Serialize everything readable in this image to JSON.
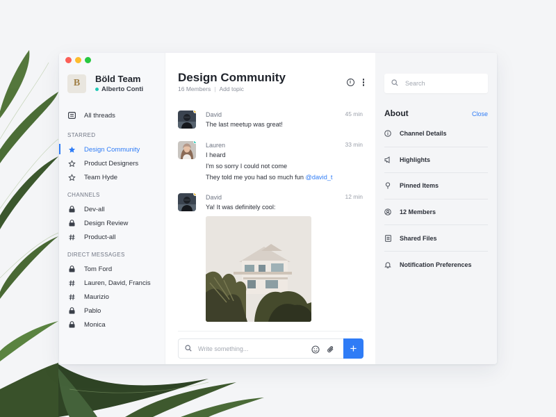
{
  "sidebar": {
    "team_logo": "B",
    "team_name": "Böld Team",
    "user_name": "Alberto Conti",
    "all_threads": "All threads",
    "starred_heading": "STARRED",
    "starred": [
      "Design Community",
      "Product Designers",
      "Team Hyde"
    ],
    "channels_heading": "CHANNELS",
    "channels": [
      "Dev-all",
      "Design Review",
      "Product-all"
    ],
    "dm_heading": "DIRECT MESSAGES",
    "direct_messages": [
      "Tom Ford",
      "Lauren, David, Francis",
      "Maurizio",
      "Pablo",
      "Monica"
    ]
  },
  "channel": {
    "title": "Design Community",
    "members": "16 Members",
    "separator": "|",
    "add_topic": "Add topic"
  },
  "messages": [
    {
      "author": "David",
      "time": "45 min",
      "lines": [
        "The last meetup was great!"
      ]
    },
    {
      "author": "Lauren",
      "time": "33 min",
      "lines": [
        "I heard",
        "I'm so sorry I could not come",
        "They told me you had so much fun"
      ],
      "mention": "@david_t"
    },
    {
      "author": "David",
      "time": "12 min",
      "lines": [
        "Ya! It was definitely cool:"
      ]
    }
  ],
  "composer": {
    "placeholder": "Write something...",
    "send_label": "+"
  },
  "about": {
    "search_placeholder": "Search",
    "title": "About",
    "close": "Close",
    "items": [
      "Channel Details",
      "Highlights",
      "Pinned Items",
      "12 Members",
      "Shared Files",
      "Notification Preferences"
    ]
  },
  "colors": {
    "accent": "#2f7cf6",
    "online": "#21c9b6",
    "away": "#f6c33b"
  },
  "icons": {
    "all_threads": "threads-icon",
    "starred_active": "star-filled-icon",
    "starred": "star-outline-icon",
    "channel_private": "lock-icon",
    "channel_public": "hash-icon"
  }
}
